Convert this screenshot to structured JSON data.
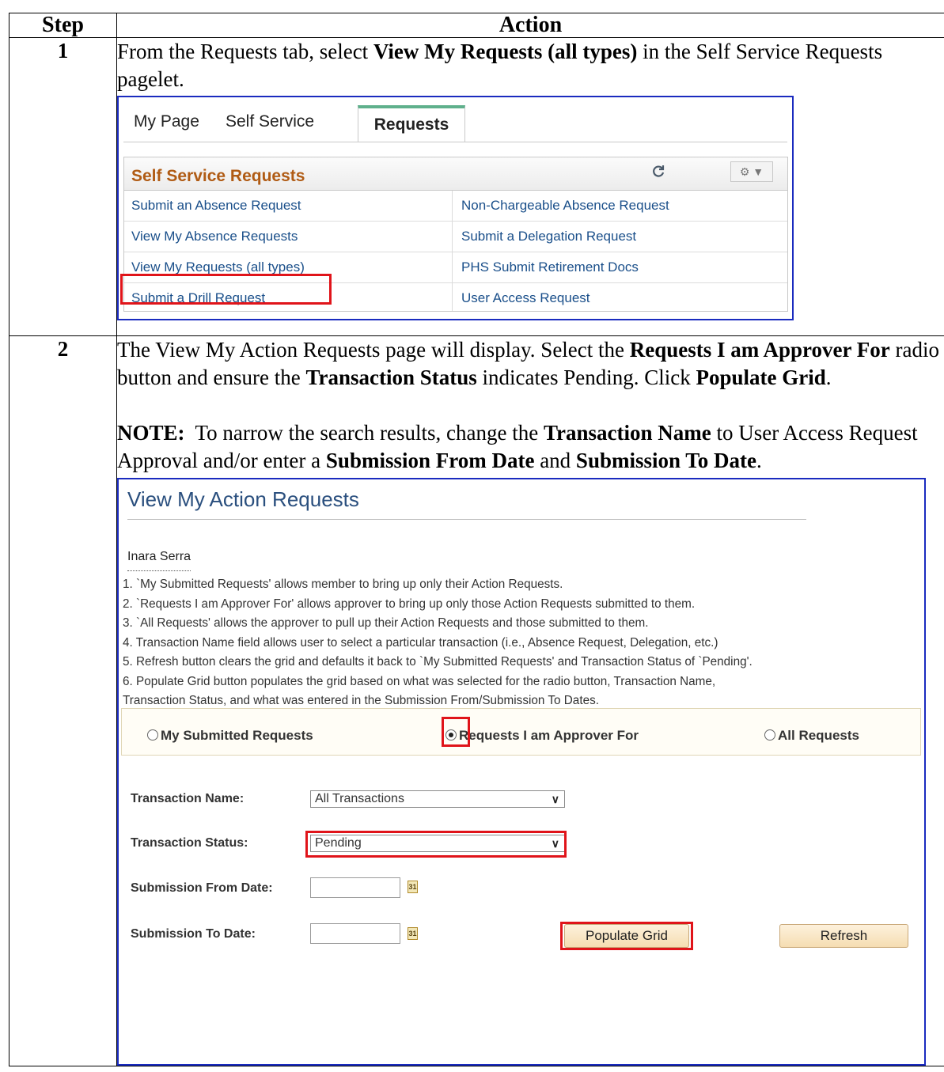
{
  "table": {
    "header_step": "Step",
    "header_action": "Action"
  },
  "step1": {
    "number": "1",
    "text_before": "From the Requests tab, select ",
    "text_bold": "View My Requests (all types)",
    "text_after": " in the Self Service Requests pagelet.",
    "screenshot": {
      "tabs": [
        "My Page",
        "Self Service",
        "Requests"
      ],
      "pagelet_title": "Self Service Requests",
      "links_left": [
        "Submit an Absence Request",
        "View My Absence Requests",
        "View My Requests (all types)",
        "Submit a Drill Request"
      ],
      "links_right": [
        "Non-Chargeable Absence Request",
        "Submit a Delegation Request",
        "PHS Submit Retirement Docs",
        "User Access Request"
      ]
    }
  },
  "step2": {
    "number": "2",
    "p1_a": "The View My Action Requests page will display.  Select the ",
    "p1_b": "Requests I am Approver For",
    "p1_c": " radio button and ensure the ",
    "p1_d": "Transaction Status",
    "p1_e": " indicates Pending.  Click ",
    "p1_f": "Populate Grid",
    "p1_g": ".",
    "note_label": "NOTE:",
    "note_a": "  To narrow the search results, change the ",
    "note_b": "Transaction Name",
    "note_c": " to User Access Request Approval and/or enter a ",
    "note_d": "Submission From Date",
    "note_e": " and ",
    "note_f": "Submission To Date",
    "note_g": ".",
    "screenshot": {
      "title": "View My Action Requests",
      "member_name": "Inara Serra",
      "notes": [
        "1. `My Submitted Requests' allows member to bring up only their Action Requests.",
        "2. `Requests I am Approver For' allows approver to bring up only those Action Requests submitted to them.",
        "3. `All Requests' allows the approver to pull up their Action Requests and those submitted to them.",
        "4. Transaction Name field allows user to select a particular transaction (i.e., Absence Request, Delegation, etc.)",
        "5. Refresh button clears the grid and defaults it back to `My Submitted Requests' and Transaction Status of `Pending'.",
        "6. Populate Grid button populates the grid based on what was selected for the radio button, Transaction Name,",
        "Transaction Status, and what was entered in the Submission From/Submission To Dates."
      ],
      "radios": {
        "my_submitted": "My Submitted Requests",
        "approver_for": "Requests I am Approver For",
        "all": "All Requests",
        "selected": "approver_for"
      },
      "transaction_name_label": "Transaction Name:",
      "transaction_name_value": "All Transactions",
      "transaction_status_label": "Transaction Status:",
      "transaction_status_value": "Pending",
      "from_date_label": "Submission From Date:",
      "from_date_value": "",
      "to_date_label": "Submission To Date:",
      "to_date_value": "",
      "calendar_glyph": "31",
      "populate_label": "Populate Grid",
      "refresh_label": "Refresh"
    }
  },
  "colors": {
    "highlight": "#e0141a",
    "frame": "#1a2bbf",
    "pagelet_title": "#b05b14",
    "link": "#1a4f8a"
  }
}
